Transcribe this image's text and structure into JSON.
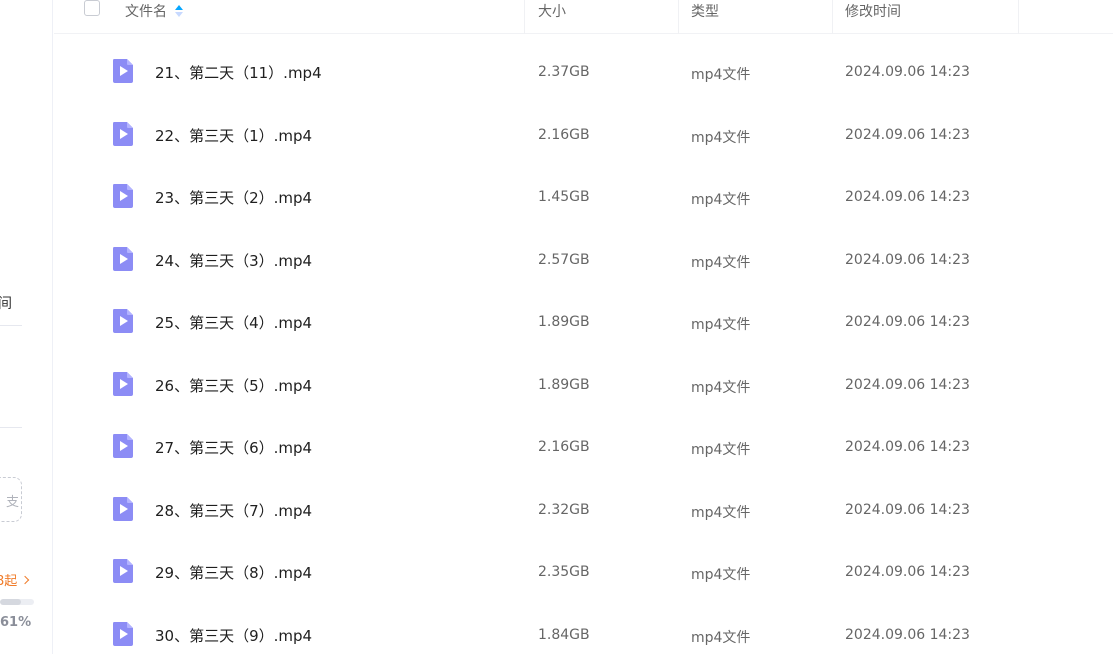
{
  "sidebar": {
    "clipped_label": "间",
    "dashed_box_text": "支",
    "upgrade_text": "8起",
    "storage_usage": "61%",
    "storage_fraction": 0.61
  },
  "header": {
    "name": "文件名",
    "size": "大小",
    "type": "类型",
    "modified": "修改时间"
  },
  "files": [
    {
      "name": "21、第二天（11）.mp4",
      "size": "2.37GB",
      "type": "mp4文件",
      "time": "2024.09.06 14:23"
    },
    {
      "name": "22、第三天（1）.mp4",
      "size": "2.16GB",
      "type": "mp4文件",
      "time": "2024.09.06 14:23"
    },
    {
      "name": "23、第三天（2）.mp4",
      "size": "1.45GB",
      "type": "mp4文件",
      "time": "2024.09.06 14:23"
    },
    {
      "name": "24、第三天（3）.mp4",
      "size": "2.57GB",
      "type": "mp4文件",
      "time": "2024.09.06 14:23"
    },
    {
      "name": "25、第三天（4）.mp4",
      "size": "1.89GB",
      "type": "mp4文件",
      "time": "2024.09.06 14:23"
    },
    {
      "name": "26、第三天（5）.mp4",
      "size": "1.89GB",
      "type": "mp4文件",
      "time": "2024.09.06 14:23"
    },
    {
      "name": "27、第三天（6）.mp4",
      "size": "2.16GB",
      "type": "mp4文件",
      "time": "2024.09.06 14:23"
    },
    {
      "name": "28、第三天（7）.mp4",
      "size": "2.32GB",
      "type": "mp4文件",
      "time": "2024.09.06 14:23"
    },
    {
      "name": "29、第三天（8）.mp4",
      "size": "2.35GB",
      "type": "mp4文件",
      "time": "2024.09.06 14:23"
    },
    {
      "name": "30、第三天（9）.mp4",
      "size": "1.84GB",
      "type": "mp4文件",
      "time": "2024.09.06 14:23"
    }
  ],
  "colors": {
    "accent": "#06a7ff",
    "video_icon": "#8c8cf5",
    "upgrade_orange": "#f07c2a"
  }
}
